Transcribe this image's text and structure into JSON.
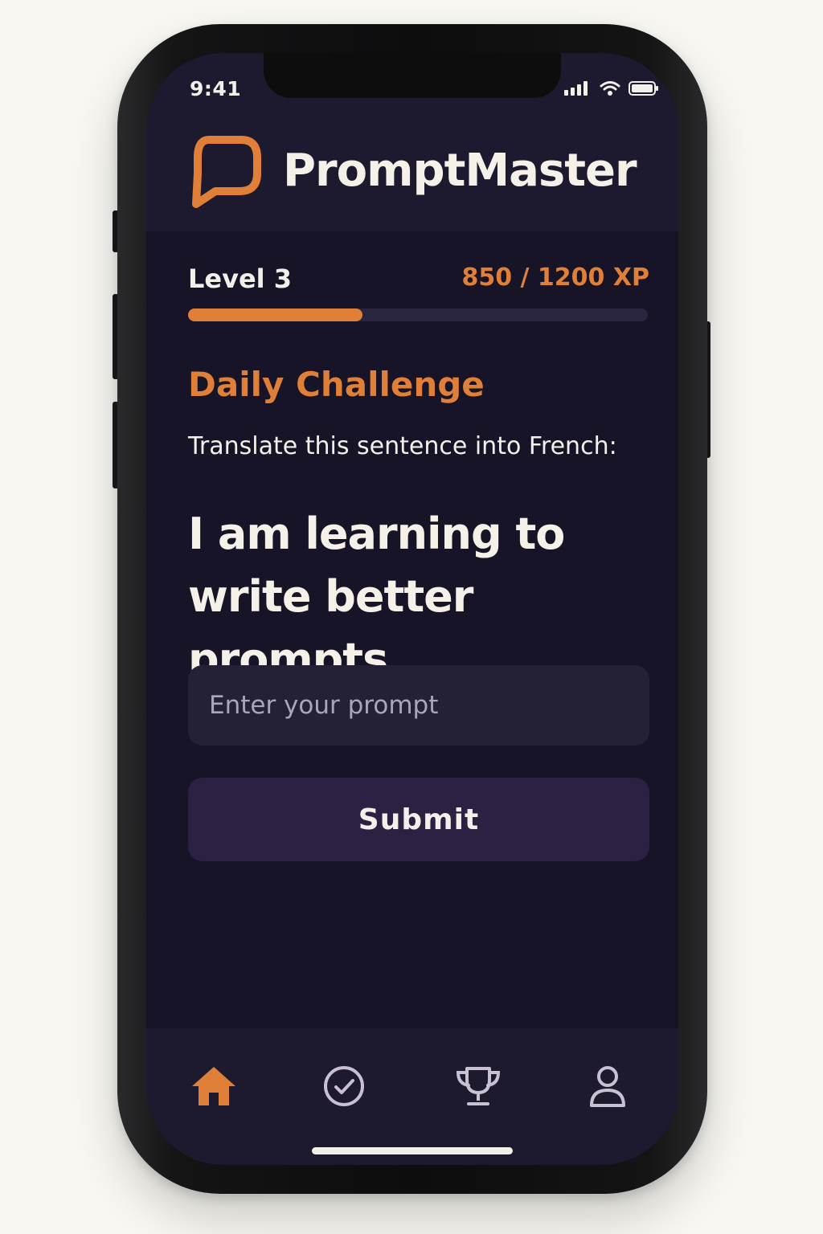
{
  "status_bar": {
    "time": "9:41",
    "icons": [
      "signal-icon",
      "wifi-icon",
      "battery-icon"
    ]
  },
  "header": {
    "app_name": "PromptMaster",
    "logo_icon": "chat-bubble-icon"
  },
  "progress": {
    "level_label": "Level 3",
    "xp_label": "850 / 1200 XP",
    "fill_fraction": 0.38
  },
  "challenge": {
    "title": "Daily Challenge",
    "instruction": "Translate this sentence into French:",
    "sentence_line1": "I am learning to",
    "sentence_line2": "write better prompts."
  },
  "prompt_input": {
    "placeholder": "Enter your prompt",
    "value": ""
  },
  "submit": {
    "label": "Submit"
  },
  "tabbar": {
    "items": [
      {
        "icon": "home-icon",
        "active": true
      },
      {
        "icon": "check-circle-icon",
        "active": false
      },
      {
        "icon": "trophy-icon",
        "active": false
      },
      {
        "icon": "profile-icon",
        "active": false
      }
    ]
  },
  "colors": {
    "accent": "#e07f37",
    "background": "#181428",
    "surface": "#1d1a30",
    "button": "#2c2142",
    "text": "#f3f0ea",
    "inactive_icon": "#c9c0d2"
  }
}
